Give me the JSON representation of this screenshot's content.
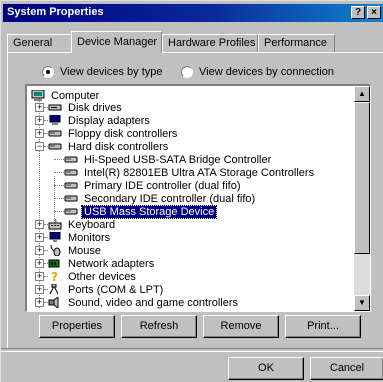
{
  "window": {
    "title": "System Properties",
    "help_label": "?",
    "close_label": "×"
  },
  "tabs": [
    {
      "label": "General"
    },
    {
      "label": "Device Manager"
    },
    {
      "label": "Hardware Profiles"
    },
    {
      "label": "Performance"
    }
  ],
  "view_options": {
    "by_type": "View devices by type",
    "by_connection": "View devices by connection",
    "selected": "by_type"
  },
  "tree": [
    {
      "label": "Computer",
      "icon": "computer-icon",
      "level": 0
    },
    {
      "label": "Disk drives",
      "icon": "disk-drive-icon",
      "level": 1,
      "expander": "+"
    },
    {
      "label": "Display adapters",
      "icon": "display-adapter-icon",
      "level": 1,
      "expander": "+"
    },
    {
      "label": "Floppy disk controllers",
      "icon": "controller-icon",
      "level": 1,
      "expander": "+"
    },
    {
      "label": "Hard disk controllers",
      "icon": "controller-icon",
      "level": 1,
      "expander": "−"
    },
    {
      "label": "Hi-Speed USB-SATA Bridge Controller",
      "icon": "controller-icon",
      "level": 2
    },
    {
      "label": "Intel(R) 82801EB Ultra ATA Storage Controllers",
      "icon": "controller-icon",
      "level": 2
    },
    {
      "label": "Primary IDE controller (dual fifo)",
      "icon": "controller-icon",
      "level": 2
    },
    {
      "label": "Secondary IDE controller (dual fifo)",
      "icon": "controller-icon",
      "level": 2
    },
    {
      "label": "USB Mass Storage Device",
      "icon": "controller-icon",
      "level": 2,
      "selected": true
    },
    {
      "label": "Keyboard",
      "icon": "keyboard-icon",
      "level": 1,
      "expander": "+"
    },
    {
      "label": "Monitors",
      "icon": "monitor-icon",
      "level": 1,
      "expander": "+"
    },
    {
      "label": "Mouse",
      "icon": "mouse-icon",
      "level": 1,
      "expander": "+"
    },
    {
      "label": "Network adapters",
      "icon": "network-adapter-icon",
      "level": 1,
      "expander": "+"
    },
    {
      "label": "Other devices",
      "icon": "question-icon",
      "level": 1,
      "expander": "+"
    },
    {
      "label": "Ports (COM & LPT)",
      "icon": "port-icon",
      "level": 1,
      "expander": "+"
    },
    {
      "label": "Sound, video and game controllers",
      "icon": "sound-icon",
      "level": 1,
      "expander": "+"
    }
  ],
  "buttons": {
    "properties": "Properties",
    "refresh": "Refresh",
    "remove": "Remove",
    "print": "Print...",
    "ok": "OK",
    "cancel": "Cancel"
  },
  "colors": {
    "titlebar": "#000080",
    "selection": "#000080",
    "face": "#c0c0c0"
  }
}
